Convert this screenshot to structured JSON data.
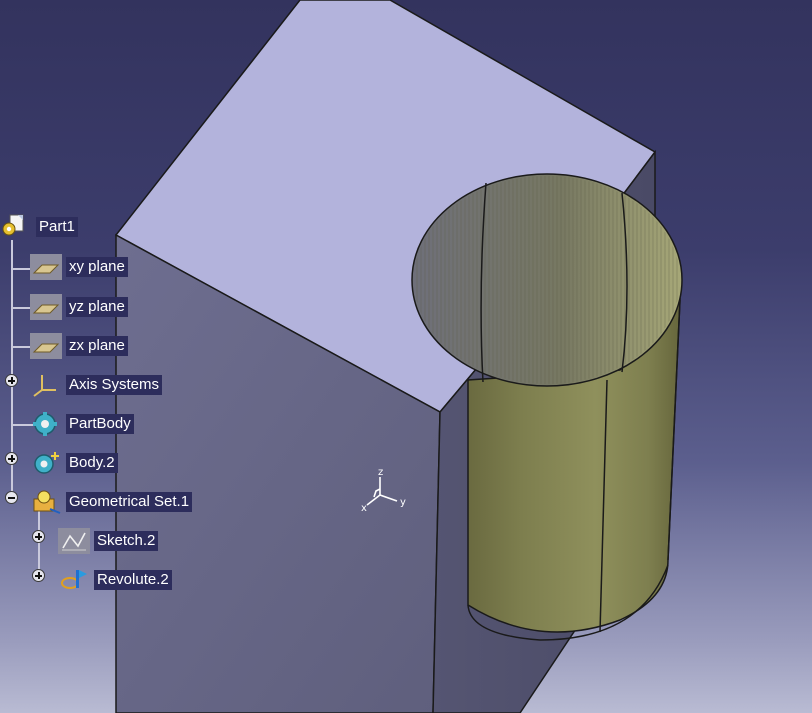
{
  "app": {
    "background_top": "#33335e",
    "background_bottom": "#b9bbd3"
  },
  "tree": {
    "root": {
      "label": "Part1",
      "icon": "part-document-icon"
    },
    "items": [
      {
        "label": "xy plane",
        "icon": "plane-icon",
        "expander": "none"
      },
      {
        "label": "yz plane",
        "icon": "plane-icon",
        "expander": "none"
      },
      {
        "label": "zx plane",
        "icon": "plane-icon",
        "expander": "none"
      },
      {
        "label": "Axis Systems",
        "icon": "axis-system-icon",
        "expander": "plus"
      },
      {
        "label": "PartBody",
        "icon": "gear-body-icon",
        "expander": "none"
      },
      {
        "label": "Body.2",
        "icon": "gear-body-icon",
        "expander": "plus"
      },
      {
        "label": "Geometrical Set.1",
        "icon": "geometrical-set-icon",
        "expander": "minus"
      }
    ],
    "children": [
      {
        "label": "Sketch.2",
        "icon": "sketch-icon",
        "expander": "plus"
      },
      {
        "label": "Revolute.2",
        "icon": "revolute-icon",
        "expander": "plus"
      }
    ]
  },
  "compass": {
    "axes": [
      "z",
      "y",
      "x"
    ]
  },
  "model": {
    "block_top_color": "#b3b3dc",
    "block_front_color": "#6a6a88",
    "cylinder_color": "#8c8d5a"
  }
}
